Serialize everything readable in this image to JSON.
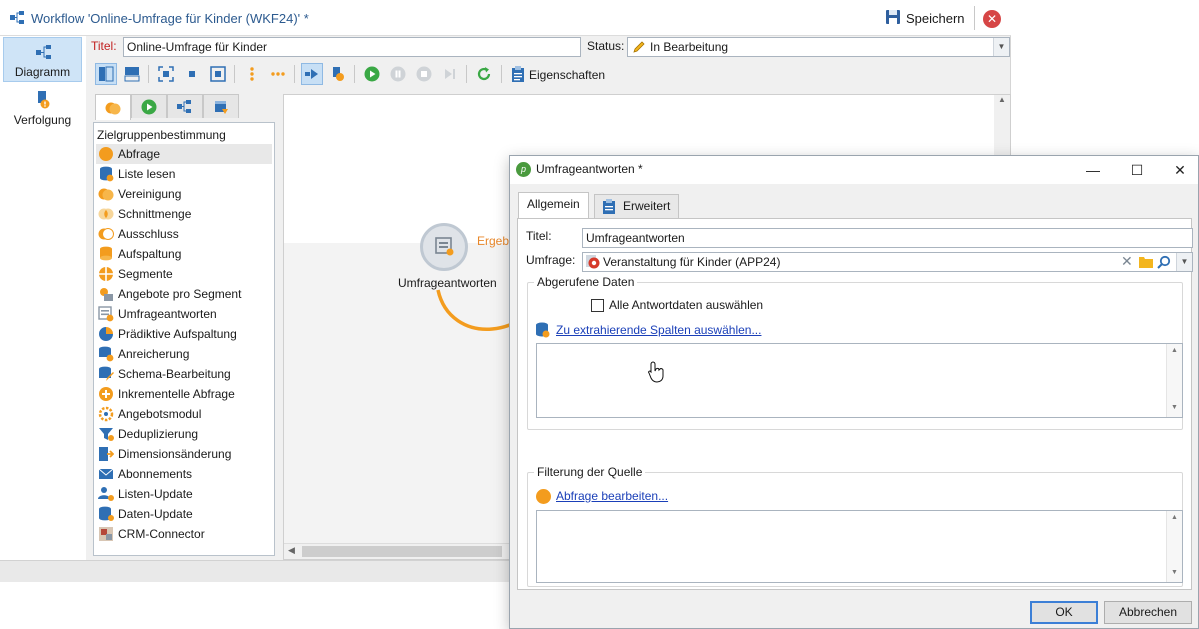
{
  "window": {
    "title": "Workflow 'Online-Umfrage für Kinder (WKF24)' *",
    "save_label": "Speichern"
  },
  "left_nav": {
    "items": [
      {
        "label": "Diagramm",
        "icon": "diagram-icon",
        "active": true
      },
      {
        "label": "Verfolgung",
        "icon": "tracking-icon",
        "active": false
      }
    ]
  },
  "form": {
    "title_label": "Titel:",
    "title_value": "Online-Umfrage für Kinder",
    "status_label": "Status:",
    "status_value": "In Bearbeitung"
  },
  "toolbar": {
    "properties_label": "Eigenschaften"
  },
  "palette": {
    "header": "Zielgruppenbestimmung",
    "items": [
      {
        "label": "Abfrage",
        "icon": "query-icon",
        "selected": true
      },
      {
        "label": "Liste lesen",
        "icon": "read-list-icon"
      },
      {
        "label": "Vereinigung",
        "icon": "union-icon"
      },
      {
        "label": "Schnittmenge",
        "icon": "intersection-icon"
      },
      {
        "label": "Ausschluss",
        "icon": "exclusion-icon"
      },
      {
        "label": "Aufspaltung",
        "icon": "split-icon"
      },
      {
        "label": "Segmente",
        "icon": "segments-icon"
      },
      {
        "label": "Angebote pro Segment",
        "icon": "offers-per-segment-icon"
      },
      {
        "label": "Umfrageantworten",
        "icon": "survey-responses-icon"
      },
      {
        "label": "Prädiktive Aufspaltung",
        "icon": "predictive-split-icon"
      },
      {
        "label": "Anreicherung",
        "icon": "enrichment-icon"
      },
      {
        "label": "Schema-Bearbeitung",
        "icon": "schema-edit-icon"
      },
      {
        "label": "Inkrementelle Abfrage",
        "icon": "incremental-query-icon"
      },
      {
        "label": "Angebotsmodul",
        "icon": "offer-engine-icon"
      },
      {
        "label": "Deduplizierung",
        "icon": "deduplication-icon"
      },
      {
        "label": "Dimensionsänderung",
        "icon": "dimension-change-icon"
      },
      {
        "label": "Abonnements",
        "icon": "subscriptions-icon"
      },
      {
        "label": "Listen-Update",
        "icon": "list-update-icon"
      },
      {
        "label": "Daten-Update",
        "icon": "data-update-icon"
      },
      {
        "label": "CRM-Connector",
        "icon": "crm-connector-icon"
      }
    ]
  },
  "canvas": {
    "node_label": "Umfrageantworten",
    "node_output_label": "Ergeb"
  },
  "dialog": {
    "title": "Umfrageantworten *",
    "tabs": [
      {
        "label": "Allgemein",
        "active": true
      },
      {
        "label": "Erweitert",
        "active": false
      }
    ],
    "title_label": "Titel:",
    "title_value": "Umfrageantworten",
    "survey_label": "Umfrage:",
    "survey_value": "Veranstaltung für Kinder (APP24)",
    "retrieved_data_group": "Abgerufene Daten",
    "all_answers_checkbox": "Alle Antwortdaten auswählen",
    "all_answers_checked": false,
    "select_columns_link": "Zu extrahierende Spalten auswählen...",
    "filter_group": "Filterung der Quelle",
    "edit_query_link": "Abfrage bearbeiten...",
    "ok_label": "OK",
    "cancel_label": "Abbrechen"
  },
  "colors": {
    "accent_orange": "#f39c1e",
    "link_blue": "#1a3fb8",
    "title_label_red": "#c21f1f",
    "window_title_blue": "#2c5a8f",
    "nav_active_bg": "#cfe4f7"
  }
}
